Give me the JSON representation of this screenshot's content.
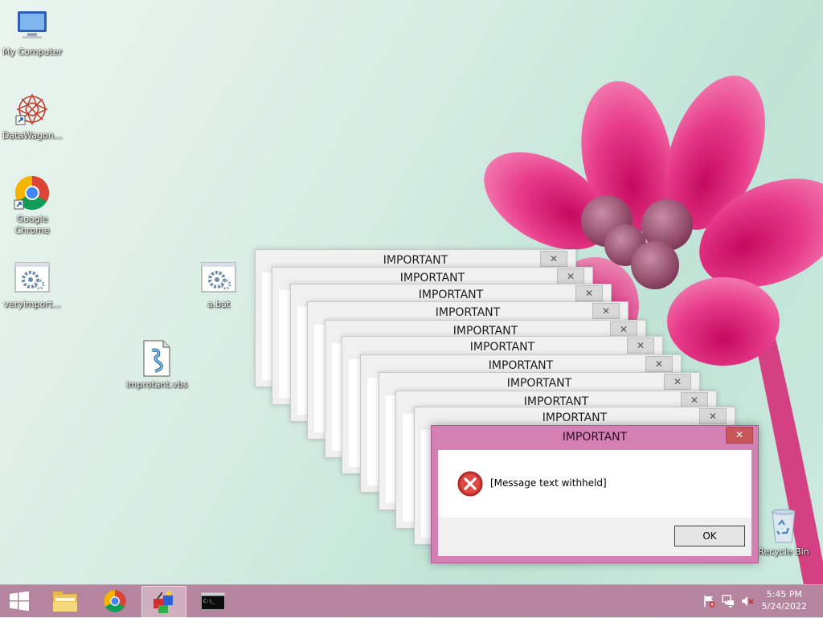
{
  "desktop": {
    "icons": [
      {
        "label": "My Computer",
        "icon": "computer-icon"
      },
      {
        "label": "DataWagon...",
        "icon": "datawagon-icon"
      },
      {
        "label": "Google Chrome",
        "icon": "chrome-icon"
      },
      {
        "label": "veryimport...",
        "icon": "batch-file-icon"
      },
      {
        "label": "a.bat",
        "icon": "batch-file-icon"
      },
      {
        "label": "improtant.vbs",
        "icon": "script-file-icon"
      },
      {
        "label": "Recycle Bin",
        "icon": "recycle-bin-icon"
      }
    ]
  },
  "stack_windows": {
    "title": "IMPORTANT",
    "close_glyph": "✕"
  },
  "dialog": {
    "title": "IMPORTANT",
    "close_glyph": "✕",
    "message": "[Message text withheld]",
    "ok_label": "OK",
    "icon": "error-icon"
  },
  "taskbar": {
    "items": [
      "start-icon",
      "file-explorer-icon",
      "chrome-icon",
      "script-host-icon",
      "command-prompt-icon"
    ],
    "tray": [
      "action-center-flag-icon",
      "network-icon",
      "volume-muted-icon"
    ],
    "time": "5:45 PM",
    "date": "5/24/2022"
  },
  "colors": {
    "taskbar": "#b5859f",
    "dialog_frame": "#d480b4",
    "close_button": "#c7555a",
    "flower": "#e0287a"
  }
}
